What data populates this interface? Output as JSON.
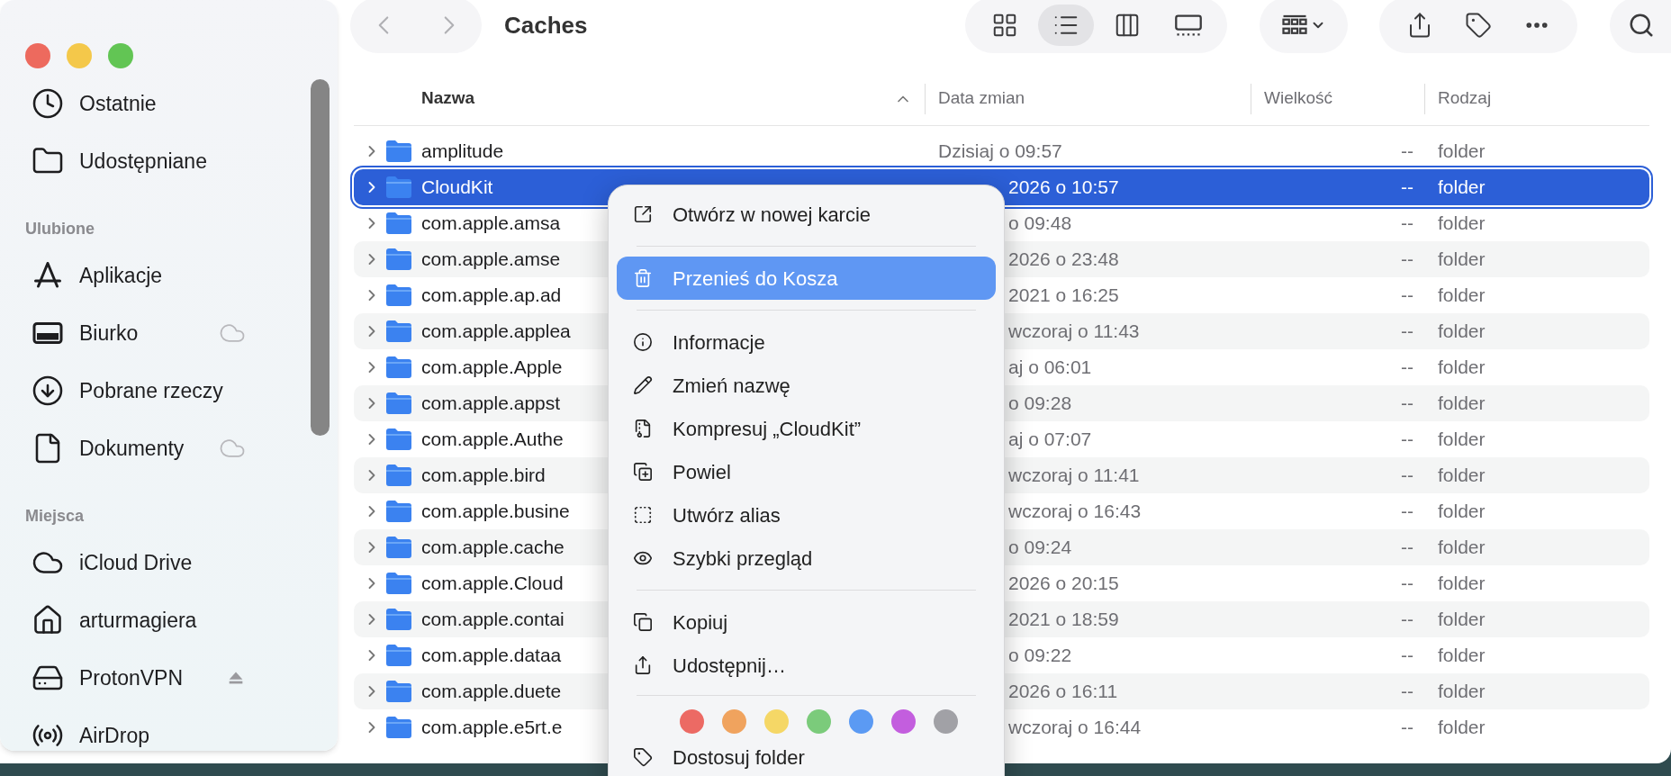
{
  "sidebar": {
    "sections": [
      {
        "items": [
          {
            "label": "Ostatnie"
          },
          {
            "label": "Udostępniane"
          }
        ]
      },
      {
        "heading": "Ulubione",
        "items": [
          {
            "label": "Aplikacje"
          },
          {
            "label": "Biurko",
            "accessory": {
              "kind": "cloud"
            }
          },
          {
            "label": "Pobrane rzeczy"
          },
          {
            "label": "Dokumenty",
            "accessory": {
              "kind": "cloud"
            }
          }
        ]
      },
      {
        "heading": "Miejsca",
        "items": [
          {
            "label": "iCloud Drive"
          },
          {
            "label": "arturmagiera"
          },
          {
            "label": "ProtonVPN",
            "accessory": {
              "kind": "eject"
            }
          },
          {
            "label": "AirDrop"
          }
        ]
      }
    ]
  },
  "toolbar": {
    "title": "Caches",
    "view_modes": [
      {
        "selected": false
      },
      {
        "selected": true
      },
      {
        "selected": false
      },
      {
        "selected": false
      }
    ]
  },
  "table": {
    "columns": [
      {
        "label": "Nazwa",
        "sorted": true
      },
      {
        "label": "Data zmian",
        "sorted": false
      },
      {
        "label": "Wielkość",
        "sorted": false
      },
      {
        "label": "Rodzaj",
        "sorted": false
      }
    ],
    "rows": [
      {
        "name": "amplitude",
        "modified": "Dzisiaj o 09:57",
        "size": "--",
        "kind": "folder",
        "selected": false,
        "date_cut": false
      },
      {
        "name": "CloudKit",
        "modified": "2026 o 10:57",
        "size": "--",
        "kind": "folder",
        "selected": true,
        "date_cut": true
      },
      {
        "name": "com.apple.amsa",
        "modified": "o 09:48",
        "size": "--",
        "kind": "folder",
        "selected": false,
        "date_cut": true
      },
      {
        "name": "com.apple.amse",
        "modified": "2026 o 23:48",
        "size": "--",
        "kind": "folder",
        "selected": false,
        "date_cut": true
      },
      {
        "name": "com.apple.ap.ad",
        "modified": "2021 o 16:25",
        "size": "--",
        "kind": "folder",
        "selected": false,
        "date_cut": true
      },
      {
        "name": "com.apple.applea",
        "modified": "wczoraj o 11:43",
        "size": "--",
        "kind": "folder",
        "selected": false,
        "date_cut": true
      },
      {
        "name": "com.apple.Apple",
        "modified": "aj o 06:01",
        "size": "--",
        "kind": "folder",
        "selected": false,
        "date_cut": true
      },
      {
        "name": "com.apple.appst",
        "modified": "o 09:28",
        "size": "--",
        "kind": "folder",
        "selected": false,
        "date_cut": true
      },
      {
        "name": "com.apple.Authe",
        "modified": "aj o 07:07",
        "size": "--",
        "kind": "folder",
        "selected": false,
        "date_cut": true
      },
      {
        "name": "com.apple.bird",
        "modified": "wczoraj o 11:41",
        "size": "--",
        "kind": "folder",
        "selected": false,
        "date_cut": true
      },
      {
        "name": "com.apple.busine",
        "modified": "wczoraj o 16:43",
        "size": "--",
        "kind": "folder",
        "selected": false,
        "date_cut": true
      },
      {
        "name": "com.apple.cache",
        "modified": "o 09:24",
        "size": "--",
        "kind": "folder",
        "selected": false,
        "date_cut": true
      },
      {
        "name": "com.apple.Cloud",
        "modified": "2026 o 20:15",
        "size": "--",
        "kind": "folder",
        "selected": false,
        "date_cut": true
      },
      {
        "name": "com.apple.contai",
        "modified": "2021 o 18:59",
        "size": "--",
        "kind": "folder",
        "selected": false,
        "date_cut": true
      },
      {
        "name": "com.apple.dataa",
        "modified": "o 09:22",
        "size": "--",
        "kind": "folder",
        "selected": false,
        "date_cut": true
      },
      {
        "name": "com.apple.duete",
        "modified": "2026 o 16:11",
        "size": "--",
        "kind": "folder",
        "selected": false,
        "date_cut": true
      },
      {
        "name": "com.apple.e5rt.e",
        "modified": "wczoraj o 16:44",
        "size": "--",
        "kind": "folder",
        "selected": false,
        "date_cut": true
      }
    ]
  },
  "context_menu": {
    "groups": [
      {
        "items": [
          {
            "label": "Otwórz w nowej karcie",
            "selected": false
          }
        ]
      },
      {
        "items": [
          {
            "label": "Przenieś do Kosza",
            "selected": true
          }
        ]
      },
      {
        "items": [
          {
            "label": "Informacje",
            "selected": false
          },
          {
            "label": "Zmień nazwę",
            "selected": false
          },
          {
            "label": "Kompresuj „CloudKit”",
            "selected": false
          },
          {
            "label": "Powiel",
            "selected": false
          },
          {
            "label": "Utwórz alias",
            "selected": false
          },
          {
            "label": "Szybki przegląd",
            "selected": false
          }
        ]
      },
      {
        "items": [
          {
            "label": "Kopiuj",
            "selected": false
          },
          {
            "label": "Udostępnij…",
            "selected": false
          }
        ]
      }
    ],
    "tags": [
      {
        "color": "#ec6a64"
      },
      {
        "color": "#f0a35e"
      },
      {
        "color": "#f5d766"
      },
      {
        "color": "#7bcb7b"
      },
      {
        "color": "#5b9af3"
      },
      {
        "color": "#c35ede"
      },
      {
        "color": "#a1a1a6"
      }
    ],
    "last_item": {
      "label": "Dostosuj folder"
    }
  }
}
